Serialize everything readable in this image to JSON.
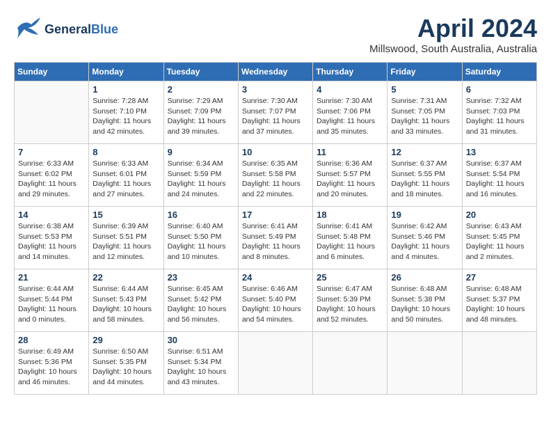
{
  "header": {
    "logo_general": "General",
    "logo_blue": "Blue",
    "month_title": "April 2024",
    "location": "Millswood, South Australia, Australia"
  },
  "days_of_week": [
    "Sunday",
    "Monday",
    "Tuesday",
    "Wednesday",
    "Thursday",
    "Friday",
    "Saturday"
  ],
  "weeks": [
    [
      {
        "day": "",
        "info": ""
      },
      {
        "day": "1",
        "info": "Sunrise: 7:28 AM\nSunset: 7:10 PM\nDaylight: 11 hours\nand 42 minutes."
      },
      {
        "day": "2",
        "info": "Sunrise: 7:29 AM\nSunset: 7:09 PM\nDaylight: 11 hours\nand 39 minutes."
      },
      {
        "day": "3",
        "info": "Sunrise: 7:30 AM\nSunset: 7:07 PM\nDaylight: 11 hours\nand 37 minutes."
      },
      {
        "day": "4",
        "info": "Sunrise: 7:30 AM\nSunset: 7:06 PM\nDaylight: 11 hours\nand 35 minutes."
      },
      {
        "day": "5",
        "info": "Sunrise: 7:31 AM\nSunset: 7:05 PM\nDaylight: 11 hours\nand 33 minutes."
      },
      {
        "day": "6",
        "info": "Sunrise: 7:32 AM\nSunset: 7:03 PM\nDaylight: 11 hours\nand 31 minutes."
      }
    ],
    [
      {
        "day": "7",
        "info": "Sunrise: 6:33 AM\nSunset: 6:02 PM\nDaylight: 11 hours\nand 29 minutes."
      },
      {
        "day": "8",
        "info": "Sunrise: 6:33 AM\nSunset: 6:01 PM\nDaylight: 11 hours\nand 27 minutes."
      },
      {
        "day": "9",
        "info": "Sunrise: 6:34 AM\nSunset: 5:59 PM\nDaylight: 11 hours\nand 24 minutes."
      },
      {
        "day": "10",
        "info": "Sunrise: 6:35 AM\nSunset: 5:58 PM\nDaylight: 11 hours\nand 22 minutes."
      },
      {
        "day": "11",
        "info": "Sunrise: 6:36 AM\nSunset: 5:57 PM\nDaylight: 11 hours\nand 20 minutes."
      },
      {
        "day": "12",
        "info": "Sunrise: 6:37 AM\nSunset: 5:55 PM\nDaylight: 11 hours\nand 18 minutes."
      },
      {
        "day": "13",
        "info": "Sunrise: 6:37 AM\nSunset: 5:54 PM\nDaylight: 11 hours\nand 16 minutes."
      }
    ],
    [
      {
        "day": "14",
        "info": "Sunrise: 6:38 AM\nSunset: 5:53 PM\nDaylight: 11 hours\nand 14 minutes."
      },
      {
        "day": "15",
        "info": "Sunrise: 6:39 AM\nSunset: 5:51 PM\nDaylight: 11 hours\nand 12 minutes."
      },
      {
        "day": "16",
        "info": "Sunrise: 6:40 AM\nSunset: 5:50 PM\nDaylight: 11 hours\nand 10 minutes."
      },
      {
        "day": "17",
        "info": "Sunrise: 6:41 AM\nSunset: 5:49 PM\nDaylight: 11 hours\nand 8 minutes."
      },
      {
        "day": "18",
        "info": "Sunrise: 6:41 AM\nSunset: 5:48 PM\nDaylight: 11 hours\nand 6 minutes."
      },
      {
        "day": "19",
        "info": "Sunrise: 6:42 AM\nSunset: 5:46 PM\nDaylight: 11 hours\nand 4 minutes."
      },
      {
        "day": "20",
        "info": "Sunrise: 6:43 AM\nSunset: 5:45 PM\nDaylight: 11 hours\nand 2 minutes."
      }
    ],
    [
      {
        "day": "21",
        "info": "Sunrise: 6:44 AM\nSunset: 5:44 PM\nDaylight: 11 hours\nand 0 minutes."
      },
      {
        "day": "22",
        "info": "Sunrise: 6:44 AM\nSunset: 5:43 PM\nDaylight: 10 hours\nand 58 minutes."
      },
      {
        "day": "23",
        "info": "Sunrise: 6:45 AM\nSunset: 5:42 PM\nDaylight: 10 hours\nand 56 minutes."
      },
      {
        "day": "24",
        "info": "Sunrise: 6:46 AM\nSunset: 5:40 PM\nDaylight: 10 hours\nand 54 minutes."
      },
      {
        "day": "25",
        "info": "Sunrise: 6:47 AM\nSunset: 5:39 PM\nDaylight: 10 hours\nand 52 minutes."
      },
      {
        "day": "26",
        "info": "Sunrise: 6:48 AM\nSunset: 5:38 PM\nDaylight: 10 hours\nand 50 minutes."
      },
      {
        "day": "27",
        "info": "Sunrise: 6:48 AM\nSunset: 5:37 PM\nDaylight: 10 hours\nand 48 minutes."
      }
    ],
    [
      {
        "day": "28",
        "info": "Sunrise: 6:49 AM\nSunset: 5:36 PM\nDaylight: 10 hours\nand 46 minutes."
      },
      {
        "day": "29",
        "info": "Sunrise: 6:50 AM\nSunset: 5:35 PM\nDaylight: 10 hours\nand 44 minutes."
      },
      {
        "day": "30",
        "info": "Sunrise: 6:51 AM\nSunset: 5:34 PM\nDaylight: 10 hours\nand 43 minutes."
      },
      {
        "day": "",
        "info": ""
      },
      {
        "day": "",
        "info": ""
      },
      {
        "day": "",
        "info": ""
      },
      {
        "day": "",
        "info": ""
      }
    ]
  ]
}
